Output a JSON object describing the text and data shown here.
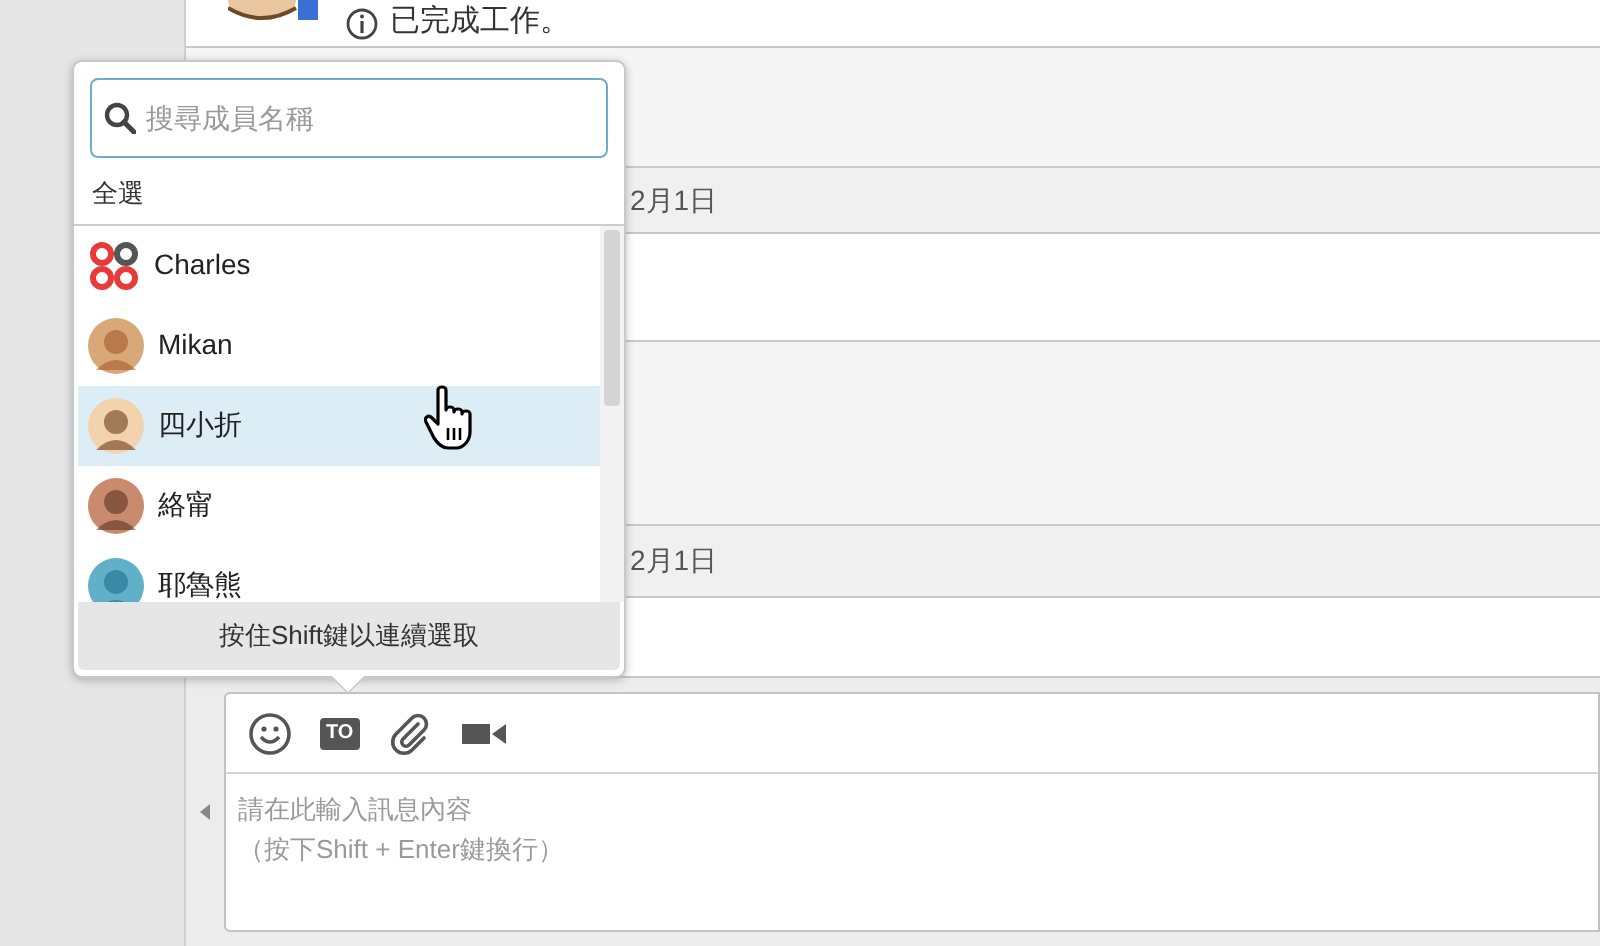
{
  "message_list": {
    "rows": [
      {
        "kind": "system",
        "text": "已完成工作。"
      },
      {
        "kind": "notice"
      },
      {
        "kind": "date",
        "text": "2月1日"
      },
      {
        "kind": "message"
      },
      {
        "kind": "notice"
      },
      {
        "kind": "date",
        "text": "2月1日"
      },
      {
        "kind": "message"
      }
    ]
  },
  "member_picker": {
    "search": {
      "placeholder": "搜尋成員名稱"
    },
    "select_all": "全選",
    "members": [
      {
        "name": "Charles",
        "kind": "logo",
        "selected": false
      },
      {
        "name": "Mikan",
        "kind": "person",
        "selected": false
      },
      {
        "name": "四小折",
        "kind": "person",
        "selected": true
      },
      {
        "name": "絡甯",
        "kind": "person",
        "selected": false
      },
      {
        "name": "耶魯熊",
        "kind": "person",
        "selected": false
      }
    ],
    "footer": "按住Shift鍵以連續選取"
  },
  "composer": {
    "toolbar": [
      {
        "kind": "emoji"
      },
      {
        "kind": "to",
        "label": "TO"
      },
      {
        "kind": "attach"
      },
      {
        "kind": "video"
      }
    ],
    "placeholder_lines": [
      "請在此輸入訊息內容",
      "（按下Shift + Enter鍵換行）"
    ]
  }
}
